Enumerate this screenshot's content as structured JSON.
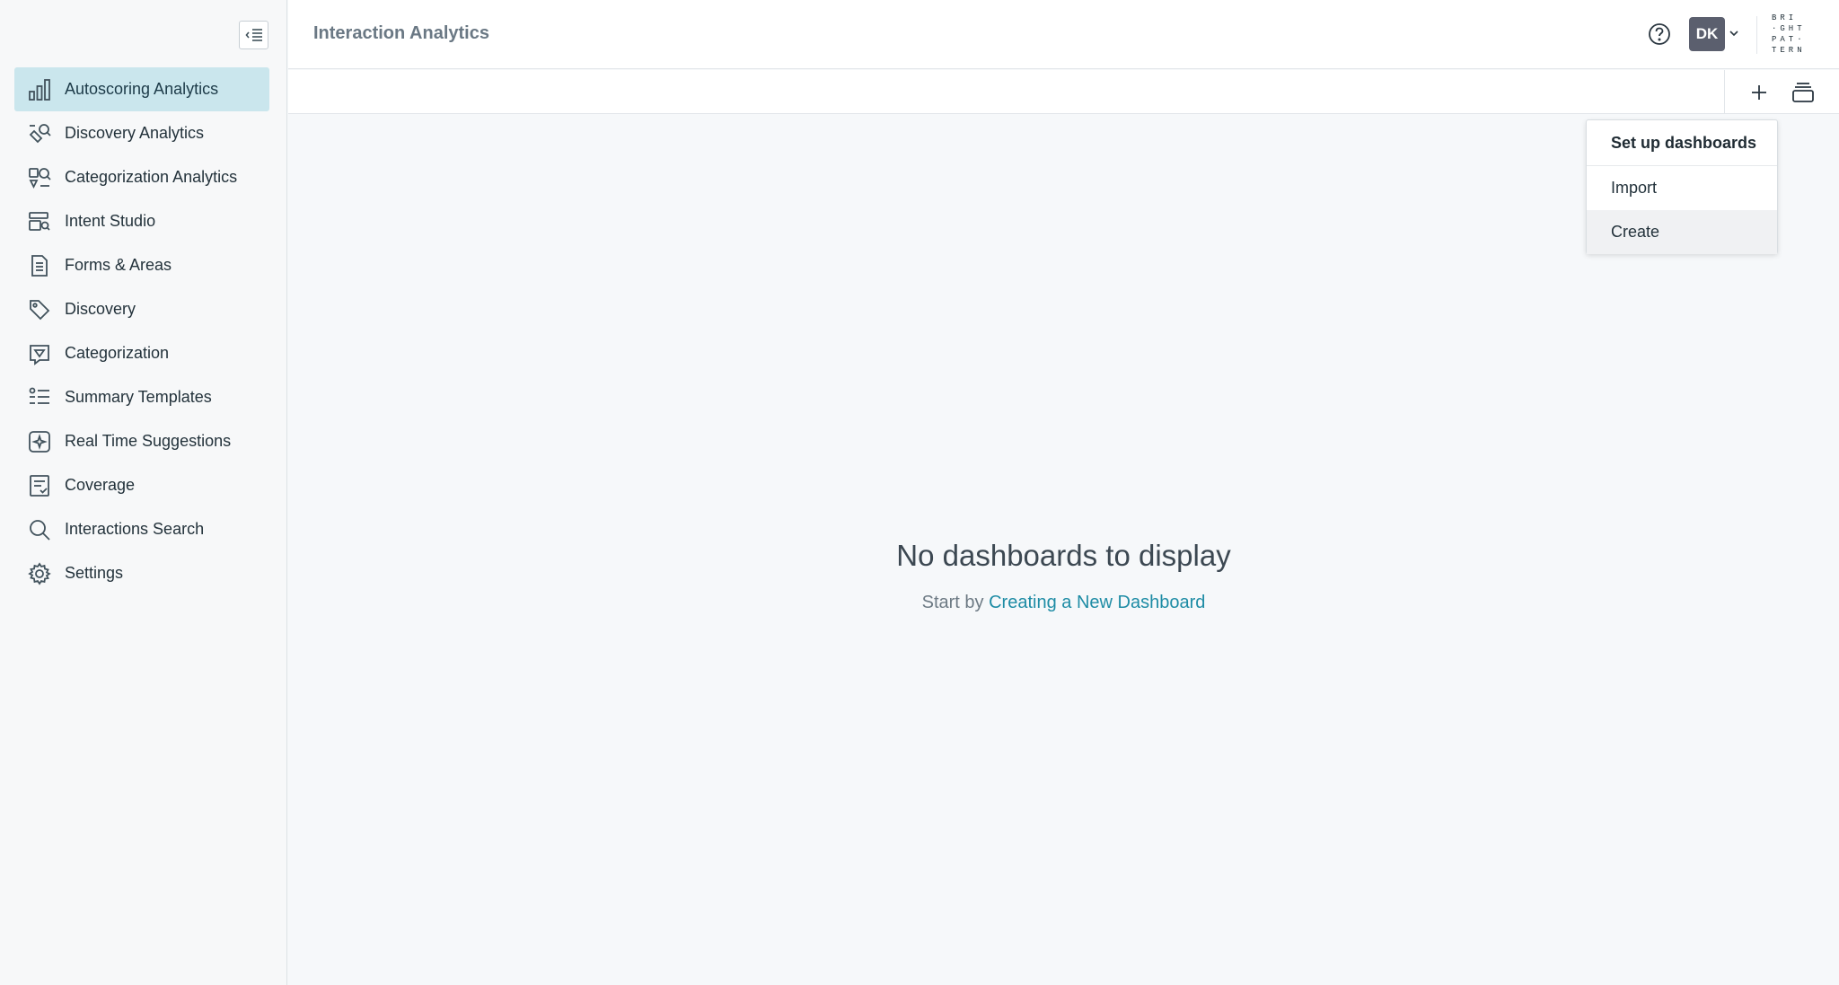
{
  "header": {
    "title": "Interaction Analytics",
    "avatar_initials": "DK",
    "brand_lines": [
      "BRI",
      "·GHT",
      "PAT·",
      "TERN"
    ]
  },
  "sidebar": {
    "items": [
      {
        "label": "Autoscoring Analytics",
        "icon": "bar-chart-icon",
        "active": true
      },
      {
        "label": "Discovery Analytics",
        "icon": "discovery-analytics-icon"
      },
      {
        "label": "Categorization Analytics",
        "icon": "categorization-analytics-icon"
      },
      {
        "label": "Intent Studio",
        "icon": "intent-studio-icon"
      },
      {
        "label": "Forms & Areas",
        "icon": "form-document-icon"
      },
      {
        "label": "Discovery",
        "icon": "tag-icon"
      },
      {
        "label": "Categorization",
        "icon": "categorization-icon"
      },
      {
        "label": "Summary Templates",
        "icon": "summary-list-icon"
      },
      {
        "label": "Real Time Suggestions",
        "icon": "sparkle-icon"
      },
      {
        "label": "Coverage",
        "icon": "coverage-icon"
      },
      {
        "label": "Interactions Search",
        "icon": "search-icon"
      },
      {
        "label": "Settings",
        "icon": "gear-icon"
      }
    ]
  },
  "dropdown": {
    "header": "Set up dashboards",
    "items": [
      {
        "label": "Import"
      },
      {
        "label": "Create"
      }
    ]
  },
  "empty_state": {
    "title": "No dashboards to display",
    "prefix": "Start by",
    "link": "Creating a New Dashboard"
  },
  "colors": {
    "accent": "#1e8ca5",
    "active_nav_bg": "#cae6ed",
    "avatar_bg": "#5b5f6e"
  }
}
